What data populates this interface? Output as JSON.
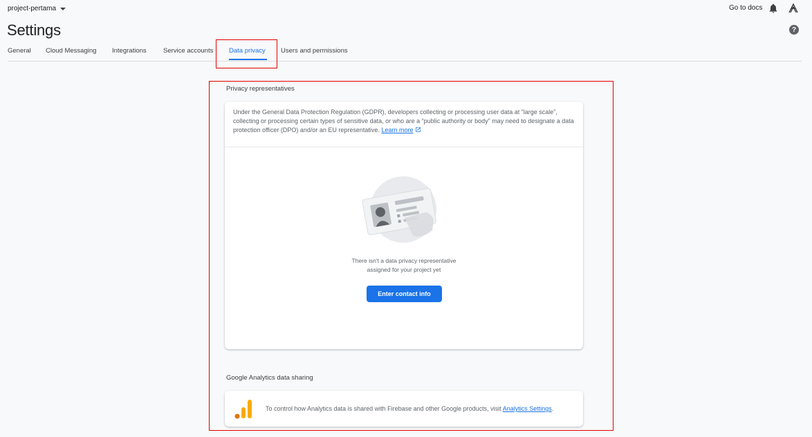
{
  "header": {
    "project_name": "project-pertama",
    "page_title": "Settings",
    "docs_link": "Go to docs"
  },
  "tabs": [
    {
      "label": "General"
    },
    {
      "label": "Cloud Messaging"
    },
    {
      "label": "Integrations"
    },
    {
      "label": "Service accounts"
    },
    {
      "label": "Data privacy",
      "active": true
    },
    {
      "label": "Users and permissions"
    }
  ],
  "privacy": {
    "section_title": "Privacy representatives",
    "description": "Under the General Data Protection Regulation (GDPR), developers collecting or processing user data at “large scale”, collecting or processing certain types of sensitive data, or who are a “public authority or body” may need to designate a data protection officer (DPO) and/or an EU representative.",
    "learn_more": "Learn more",
    "empty_line1": "There isn't a data privacy representative",
    "empty_line2": "assigned for your project yet",
    "button_label": "Enter contact info"
  },
  "analytics": {
    "section_title": "Google Analytics data sharing",
    "text": "To control how Analytics data is shared with Firebase and other Google products, visit",
    "link": "Analytics Settings",
    "suffix": "."
  },
  "icons": {
    "notifications": "bell-icon",
    "help": "help-icon",
    "external": "external-link-icon",
    "analytics": "google-analytics-logo"
  },
  "colors": {
    "accent": "#1a73e8",
    "highlight": "#e00000",
    "analytics_orange": "#f9ab00",
    "analytics_dark_orange": "#e37400"
  }
}
